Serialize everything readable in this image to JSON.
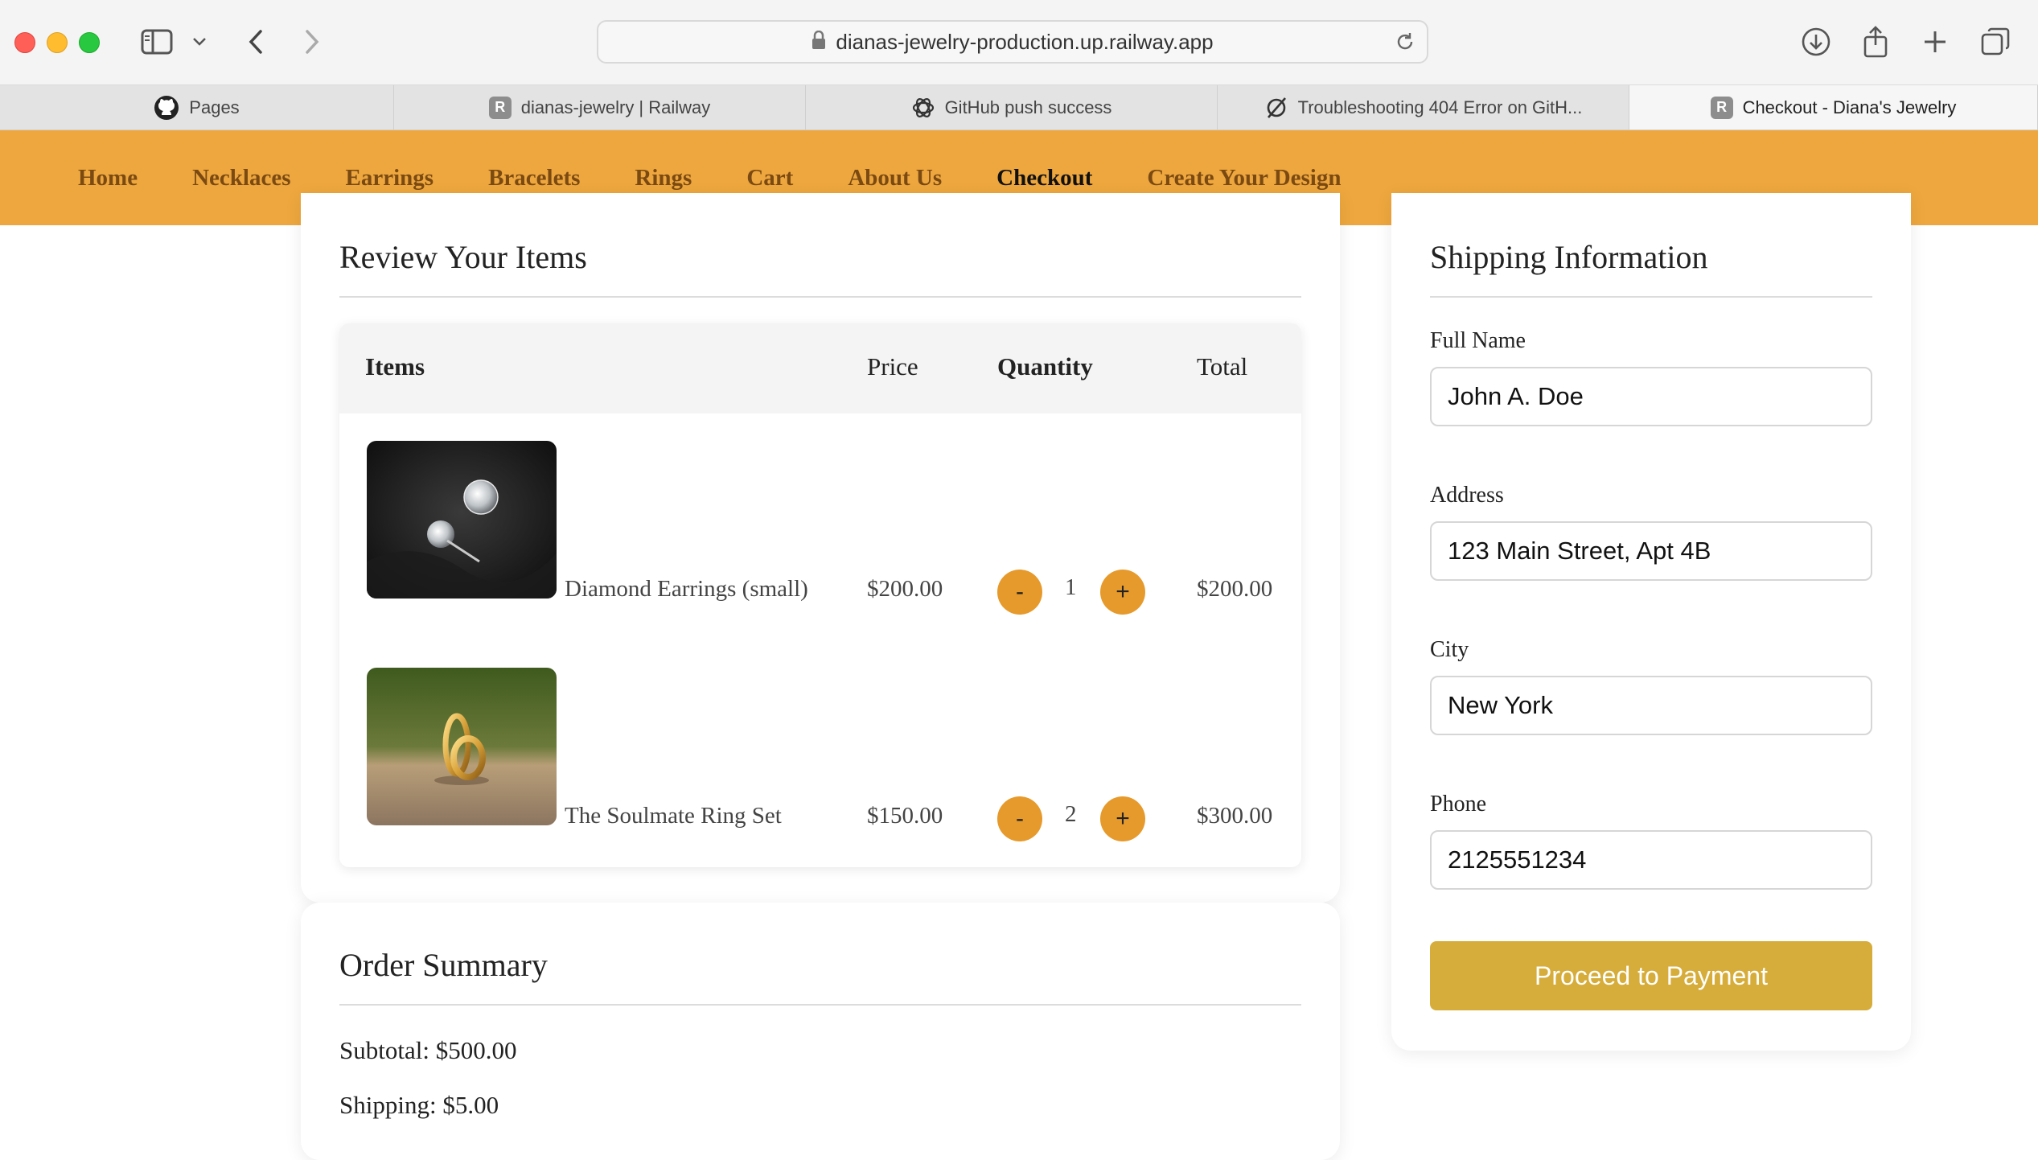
{
  "browser": {
    "url": "dianas-jewelry-production.up.railway.app",
    "tabs": [
      {
        "label": "Pages",
        "icon": "github-icon",
        "active": false
      },
      {
        "label": "dianas-jewelry | Railway",
        "icon": "railway-icon",
        "active": false
      },
      {
        "label": "GitHub push success",
        "icon": "chatgpt-icon",
        "active": false
      },
      {
        "label": "Troubleshooting 404 Error on GitH...",
        "icon": "perplexity-icon",
        "active": false
      },
      {
        "label": "Checkout - Diana's Jewelry",
        "icon": "railway-icon",
        "active": true
      }
    ],
    "railway_badge": "R"
  },
  "nav": {
    "items": [
      "Home",
      "Necklaces",
      "Earrings",
      "Bracelets",
      "Rings",
      "Cart",
      "About Us",
      "Checkout",
      "Create Your Design"
    ],
    "active": "Checkout"
  },
  "review": {
    "title": "Review Your Items",
    "headers": {
      "items": "Items",
      "price": "Price",
      "quantity": "Quantity",
      "total": "Total"
    },
    "rows": [
      {
        "name": "Diamond Earrings (small)",
        "price": "$200.00",
        "qty": "1",
        "total": "$200.00",
        "minus": "-",
        "plus": "+"
      },
      {
        "name": "The Soulmate Ring Set",
        "price": "$150.00",
        "qty": "2",
        "total": "$300.00",
        "minus": "-",
        "plus": "+"
      }
    ]
  },
  "summary": {
    "title": "Order Summary",
    "subtotal": "Subtotal: $500.00",
    "shipping": "Shipping: $5.00"
  },
  "shipping": {
    "title": "Shipping Information",
    "full_name_label": "Full Name",
    "full_name_value": "John A. Doe",
    "address_label": "Address",
    "address_value": "123 Main Street, Apt 4B",
    "city_label": "City",
    "city_value": "New York",
    "phone_label": "Phone",
    "phone_value": "2125551234",
    "submit_label": "Proceed to Payment"
  },
  "colors": {
    "nav_bg": "#eea73e",
    "qty_button": "#e69a2c",
    "pay_button": "#d6ad3a"
  }
}
